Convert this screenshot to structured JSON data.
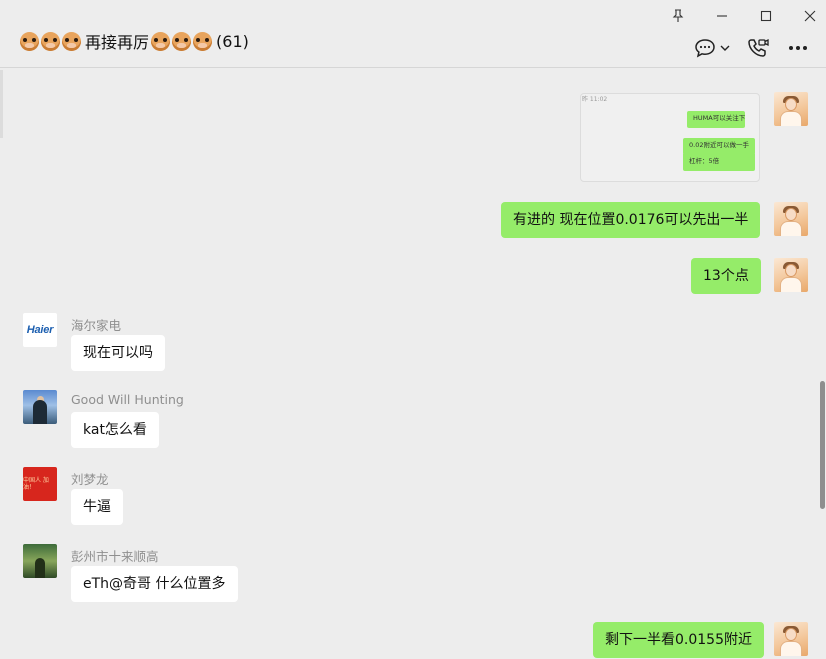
{
  "window": {
    "title_text": "再接再厉",
    "member_count": "(61)",
    "left_emoji_count": 3,
    "right_emoji_count": 3
  },
  "icons": {
    "pin": "pin-icon",
    "minimize": "minimize-icon",
    "maximize": "maximize-icon",
    "close": "close-icon",
    "chat_bubble": "chat-bubble-icon",
    "chevron": "chevron-down-icon",
    "call": "phone-video-icon",
    "more": "more-icon"
  },
  "colors": {
    "outgoing_bubble": "#95ec69",
    "incoming_bubble": "#ffffff",
    "background": "#ededed"
  },
  "screenshot_message": {
    "timestamp": "昨 11:02",
    "lines": [
      "HUMA可以关注下",
      "0.02附近可以做一手",
      "杠杆：5倍"
    ]
  },
  "messages": [
    {
      "dir": "out",
      "text": "有进的  现在位置0.0176可以先出一半"
    },
    {
      "dir": "out",
      "text": "13个点"
    },
    {
      "dir": "in",
      "sender": "海尔家电",
      "avatar_text": "Haier",
      "text": "现在可以吗"
    },
    {
      "dir": "in",
      "sender": "Good Will Hunting",
      "text": "kat怎么看"
    },
    {
      "dir": "in",
      "sender": "刘梦龙",
      "avatar_text": "中国人 加油！",
      "text": "牛逼"
    },
    {
      "dir": "in",
      "sender": "彭州市十来顺高",
      "text": "eTh@奇哥 什么位置多"
    },
    {
      "dir": "out",
      "text": "剩下一半看0.0155附近"
    }
  ]
}
